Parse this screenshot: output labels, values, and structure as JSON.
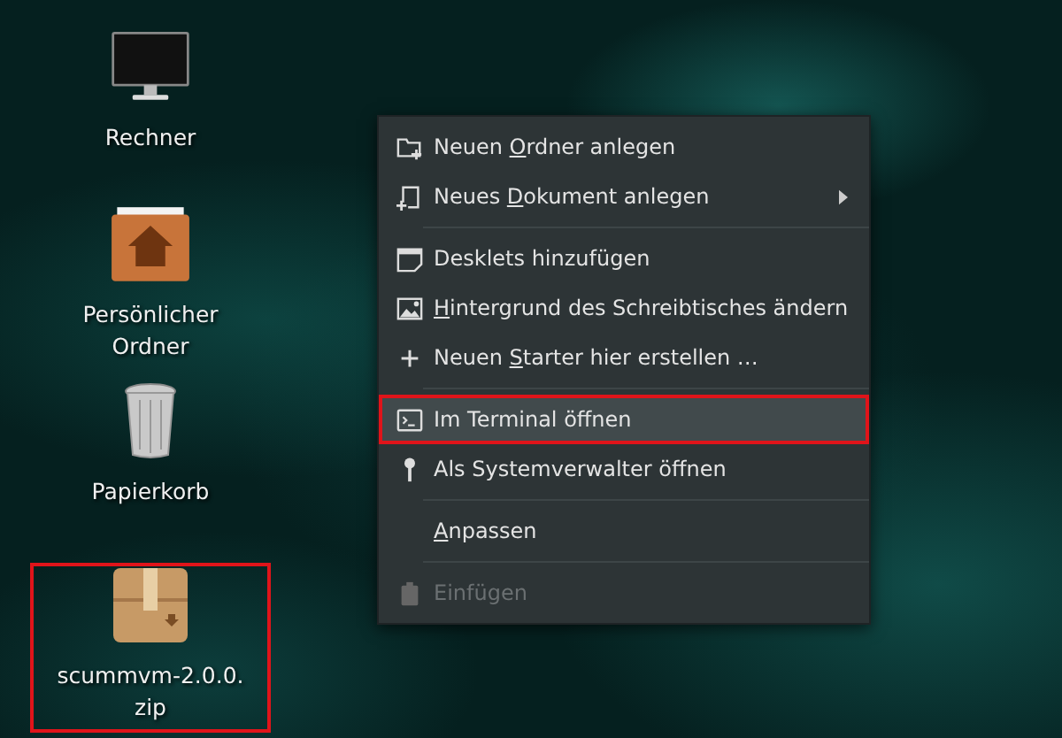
{
  "desktop_icons": [
    {
      "kind": "computer",
      "label": "Rechner",
      "highlighted": false
    },
    {
      "kind": "home-folder",
      "label": "Persönlicher Ordner",
      "highlighted": false
    },
    {
      "kind": "trash",
      "label": "Papierkorb",
      "highlighted": false
    },
    {
      "kind": "archive",
      "label": "scummvm-2.0.0. zip",
      "highlighted": true
    }
  ],
  "context_menu": {
    "groups": [
      [
        {
          "kind": "folder-plus",
          "before": "Neuen ",
          "mnemonic": "O",
          "after": "rdner anlegen",
          "submenu": false,
          "selected": false,
          "highlighted": false,
          "disabled": false
        },
        {
          "kind": "document-plus",
          "before": "Neues ",
          "mnemonic": "D",
          "after": "okument anlegen",
          "submenu": true,
          "selected": false,
          "highlighted": false,
          "disabled": false
        }
      ],
      [
        {
          "kind": "desklet",
          "before": "Desklets hinzufügen",
          "submenu": false,
          "selected": false,
          "highlighted": false,
          "disabled": false
        },
        {
          "kind": "picture",
          "mnemonic": "H",
          "after": "intergrund des Schreibtisches ändern",
          "submenu": false,
          "selected": false,
          "highlighted": false,
          "disabled": false
        },
        {
          "kind": "plus",
          "before": "Neuen ",
          "mnemonic": "S",
          "after": "tarter hier erstellen …",
          "submenu": false,
          "selected": false,
          "highlighted": false,
          "disabled": false
        }
      ],
      [
        {
          "kind": "terminal",
          "before": "Im Terminal öffnen",
          "submenu": false,
          "selected": true,
          "highlighted": true,
          "disabled": false
        },
        {
          "kind": "key",
          "before": "Als Systemverwalter öffnen",
          "submenu": false,
          "selected": false,
          "highlighted": false,
          "disabled": false
        }
      ],
      [
        {
          "kind": "plain",
          "mnemonic": "A",
          "after": "npassen",
          "submenu": false,
          "selected": false,
          "highlighted": false,
          "disabled": false
        }
      ],
      [
        {
          "kind": "clipboard",
          "before": "Einfügen",
          "submenu": false,
          "selected": false,
          "highlighted": false,
          "disabled": true
        }
      ]
    ]
  }
}
